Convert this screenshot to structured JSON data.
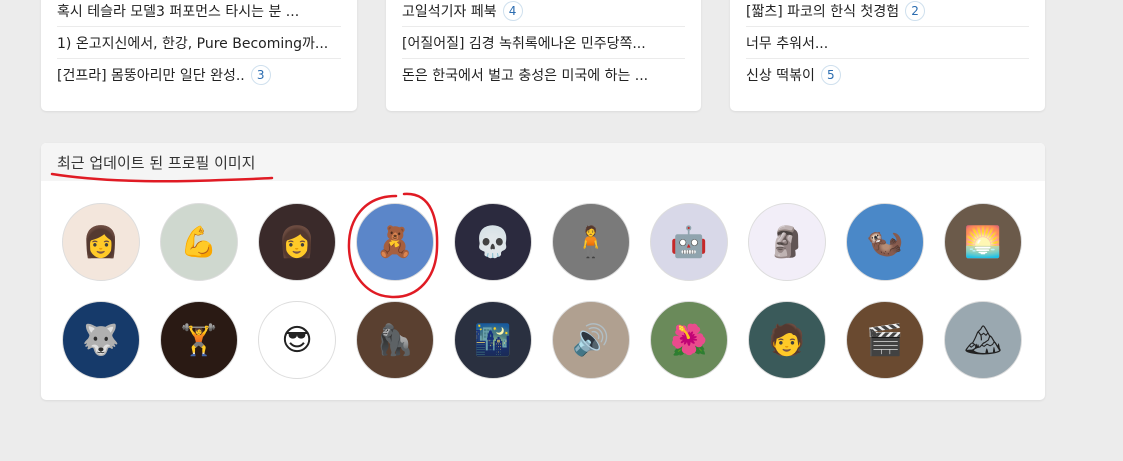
{
  "cards": [
    {
      "items": [
        {
          "text": "혹시 테슬라 모델3 퍼포먼스 타시는 분 ...",
          "badge": ""
        },
        {
          "text": "1) 온고지신에서, 한강, Pure Becoming까...",
          "badge": ""
        },
        {
          "text": "[건프라] 몸뚱아리만 일단 완성..",
          "badge": "3"
        }
      ]
    },
    {
      "items": [
        {
          "text": "고일석기자 페북",
          "badge": "4"
        },
        {
          "text": "[어질어질] 김경 녹취록에나온 민주당쪽...",
          "badge": ""
        },
        {
          "text": "돈은 한국에서 벌고 충성은 미국에 하는 ...",
          "badge": ""
        }
      ]
    },
    {
      "items": [
        {
          "text": "[짧츠] 파코의 한식 첫경험",
          "badge": "2"
        },
        {
          "text": "너무 추워서...",
          "badge": ""
        },
        {
          "text": "신상 떡볶이",
          "badge": "5"
        }
      ]
    }
  ],
  "panel": {
    "title": "최근 업데이트 된 프로필 이미지"
  },
  "avatars": [
    [
      {
        "name": "woman-portrait-avatar",
        "bg": "#f3e6dc",
        "glyph": "👩"
      },
      {
        "name": "ubermensch-logo-avatar",
        "bg": "#cfd8cf",
        "glyph": "💪"
      },
      {
        "name": "woman-closeup-avatar",
        "bg": "#3a2a2a",
        "glyph": "👩"
      },
      {
        "name": "doll-with-play-button-avatar",
        "bg": "#5b86c9",
        "glyph": "🧸"
      },
      {
        "name": "mariachi-skeleton-avatar",
        "bg": "#2b2a3e",
        "glyph": "💀"
      },
      {
        "name": "bw-figure-avatar",
        "bg": "#7a7a7a",
        "glyph": "🧍"
      },
      {
        "name": "robot-mecha-avatar",
        "bg": "#d8d8e8",
        "glyph": "🤖"
      },
      {
        "name": "statue-bust-avatar",
        "bg": "#f2eef8",
        "glyph": "🗿"
      },
      {
        "name": "otter-avatar",
        "bg": "#4a88c8",
        "glyph": "🦦"
      },
      {
        "name": "sunset-landscape-avatar",
        "bg": "#6b5a4a",
        "glyph": "🌅"
      }
    ],
    [
      {
        "name": "wolf-night-avatar",
        "bg": "#163a6a",
        "glyph": "🐺"
      },
      {
        "name": "muscle-torso-avatar",
        "bg": "#2a1a14",
        "glyph": "🏋"
      },
      {
        "name": "sunglasses-cartoon-avatar",
        "bg": "#ffffff",
        "glyph": "😎"
      },
      {
        "name": "ape-face-avatar",
        "bg": "#5a4030",
        "glyph": "🦍"
      },
      {
        "name": "night-scene-avatar",
        "bg": "#2a3040",
        "glyph": "🌃"
      },
      {
        "name": "speaker-device-avatar",
        "bg": "#b0a090",
        "glyph": "🔊"
      },
      {
        "name": "flower-garden-avatar",
        "bg": "#6a8a5a",
        "glyph": "🌺"
      },
      {
        "name": "tattooed-man-avatar",
        "bg": "#3a5a5a",
        "glyph": "🧑"
      },
      {
        "name": "film-clapper-avatar",
        "bg": "#6a4a30",
        "glyph": "🎬"
      },
      {
        "name": "snowy-mountain-avatar",
        "bg": "#9aa8b0",
        "glyph": "🏔"
      }
    ]
  ],
  "annotation_color": "#e01b24"
}
